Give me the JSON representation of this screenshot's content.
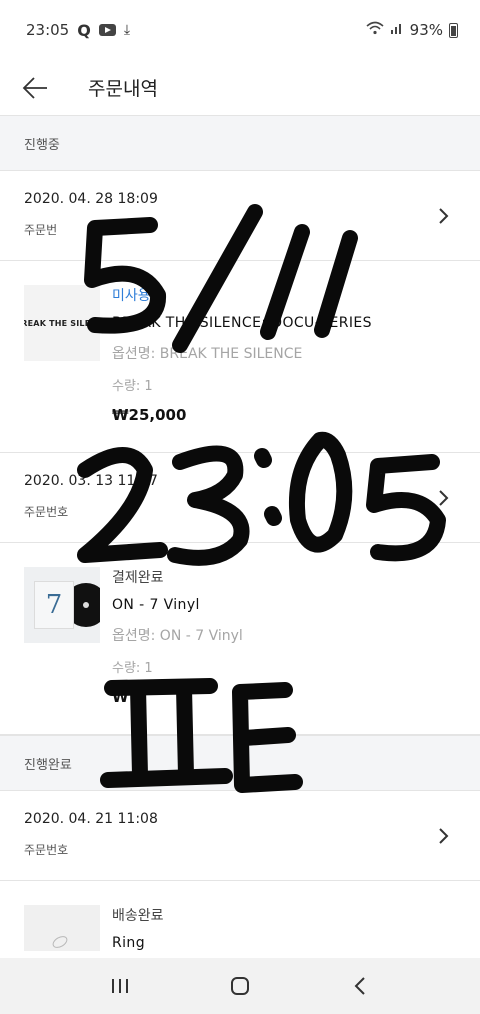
{
  "status_bar": {
    "time": "23:05",
    "battery": "93%",
    "icons": [
      "q-icon",
      "youtube-icon",
      "download-icon",
      "wifi-icon",
      "signal-icon",
      "battery-icon"
    ]
  },
  "header": {
    "title": "주문내역",
    "back_icon": "back-arrow-icon"
  },
  "sections": {
    "in_progress_label": "진행중",
    "completed_label": "진행완료"
  },
  "orders": [
    {
      "date": "2020. 04. 28 18:09",
      "number_label": "주문번",
      "product": {
        "status": "미사용",
        "name": "BREAK THE SILENCE: DOCU-SERIES",
        "option": "옵션명: BREAK THE SILENCE",
        "quantity": "수량: 1",
        "price": "₩25,000",
        "thumb_text": "BREAK THE SILENCE"
      }
    },
    {
      "date": "2020. 03. 13 11:27",
      "number_label": "주문번호",
      "product": {
        "status": "결제완료",
        "name": "ON - 7 Vinyl",
        "option": "옵션명: ON - 7 Vinyl",
        "quantity": "수량: 1",
        "price": "₩",
        "thumb_text": "7"
      }
    },
    {
      "date": "2020. 04. 21 11:08",
      "number_label": "주문번호",
      "product": {
        "status": "배송완료",
        "name": "Ring"
      }
    }
  ],
  "handwriting": {
    "line1": "5/11",
    "line2": "23:05",
    "line3": "프E"
  },
  "colors": {
    "status_blue": "#2f7ed8",
    "section_bg": "#f4f5f7",
    "nav_bg": "#f2f2f2"
  },
  "nav": {
    "recent_icon": "recent-apps-icon",
    "home_icon": "home-icon",
    "back_icon": "back-chevron-icon"
  }
}
